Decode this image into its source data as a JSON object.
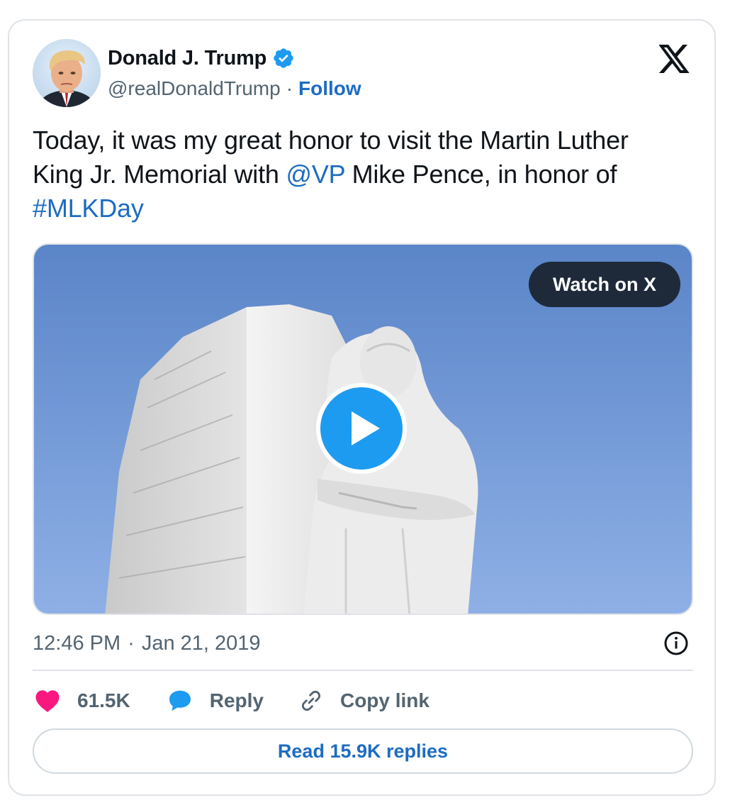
{
  "author": {
    "display_name": "Donald J. Trump",
    "handle": "@realDonaldTrump",
    "separator": "·",
    "follow_label": "Follow",
    "verified": true
  },
  "tweet": {
    "text_part1": "Today, it was my great honor to visit the Martin Luther King Jr. Memorial with ",
    "mention": "@VP",
    "text_part2": " Mike Pence, in honor of ",
    "hashtag": "#MLKDay"
  },
  "media": {
    "type": "video",
    "watch_label": "Watch on X"
  },
  "meta": {
    "time": "12:46 PM",
    "separator": "·",
    "date": "Jan 21, 2019"
  },
  "actions": {
    "likes": "61.5K",
    "reply_label": "Reply",
    "copy_label": "Copy link"
  },
  "footer": {
    "read_replies_label": "Read 15.9K replies"
  },
  "colors": {
    "link": "#1d6cc2",
    "like": "#f91880",
    "reply": "#1d9bf0",
    "play_button": "#1d9bf0",
    "muted_text": "#536471",
    "border": "#dfe3e7"
  },
  "icons": {
    "brand": "x-logo-icon",
    "verified": "verified-badge-icon",
    "play": "play-icon",
    "info": "info-icon",
    "like": "heart-icon",
    "reply": "speech-bubble-icon",
    "copy": "link-icon"
  }
}
